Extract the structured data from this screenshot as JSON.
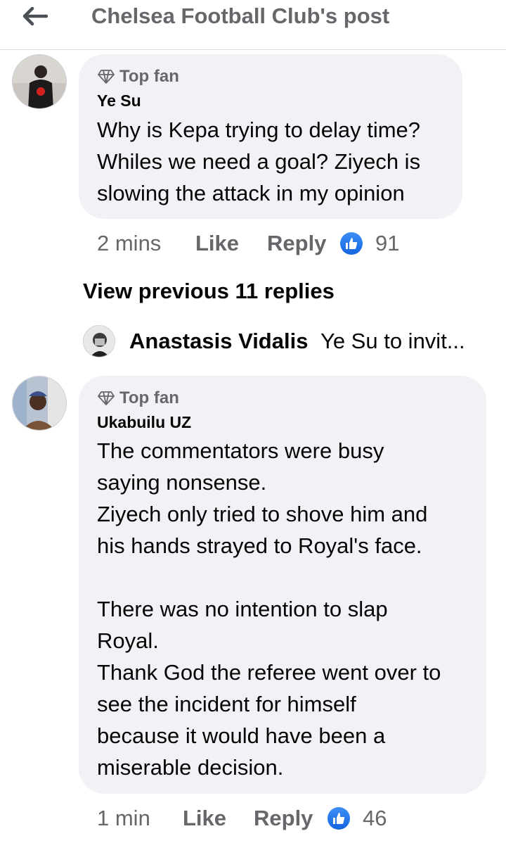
{
  "header": {
    "title": "Chelsea Football Club's post",
    "back_icon": "arrow-left-icon"
  },
  "comments": [
    {
      "badge": "Top fan",
      "author": "Ye Su",
      "text": "Why is Kepa trying to delay time?\nWhiles we need a goal? Ziyech is\nslowing the attack in my opinion",
      "time": "2 mins",
      "like_label": "Like",
      "reply_label": "Reply",
      "reaction_count": "91"
    },
    {
      "badge": "Top fan",
      "author": "Ukabuilu UZ",
      "text": "The commentators were busy\nsaying nonsense.\nZiyech only tried to shove him and\nhis hands strayed to Royal's face.\n\nThere was no intention to slap\nRoyal.\nThank God the referee went over to\nsee the incident for himself\nbecause it would have been a\nmiserable decision.",
      "time": "1 min",
      "like_label": "Like",
      "reply_label": "Reply",
      "reaction_count": "46"
    }
  ],
  "view_previous": "View previous 11 replies",
  "latest_reply": {
    "name": "Anastasis Vidalis",
    "snippet": "Ye Su to invit..."
  },
  "colors": {
    "bubble": "#f0f2f5",
    "secondary_text": "#65676b",
    "like_blue": "#1877f2"
  }
}
